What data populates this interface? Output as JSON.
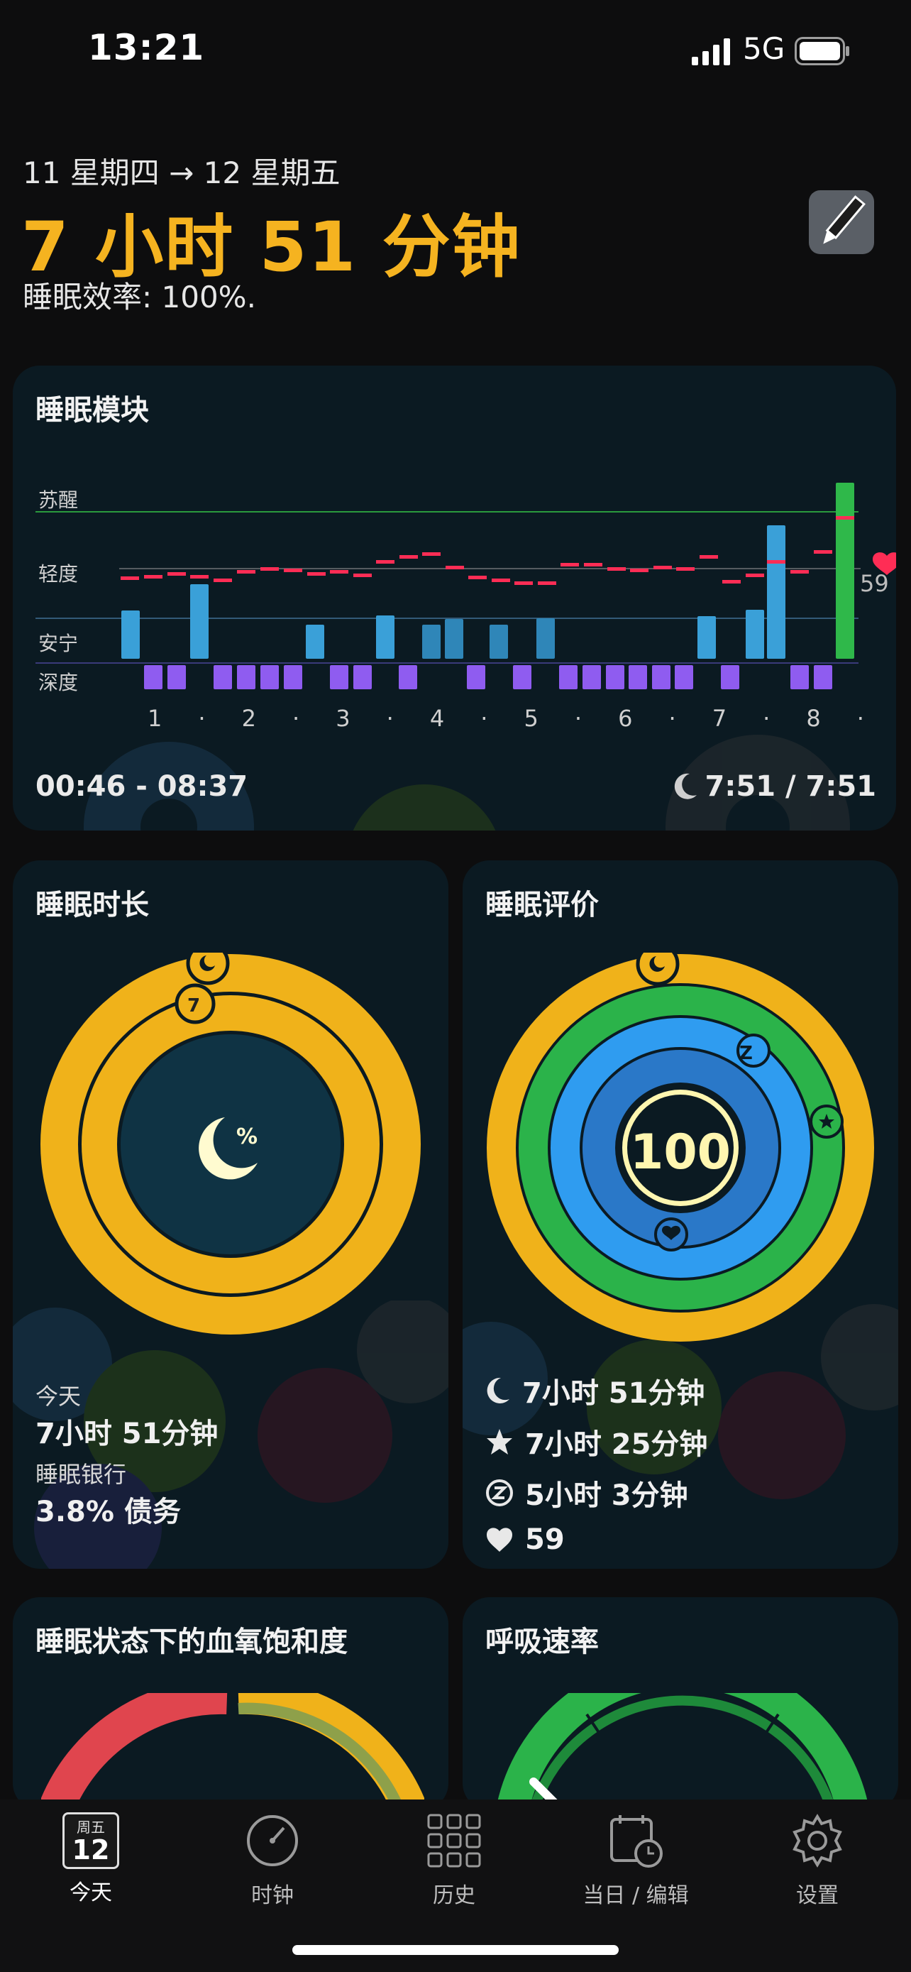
{
  "status_bar": {
    "time": "13:21",
    "network": "5G"
  },
  "header": {
    "date_range": "11 星期四 → 12 星期五",
    "total_sleep": "7 小时 51 分钟",
    "efficiency": "睡眠效率: 100%."
  },
  "sleep_module": {
    "title": "睡眠模块",
    "stages": [
      "苏醒",
      "轻度",
      "安宁",
      "深度"
    ],
    "hour_ticks": [
      "1",
      "·",
      "2",
      "·",
      "3",
      "·",
      "4",
      "·",
      "5",
      "·",
      "6",
      "·",
      "7",
      "·",
      "8",
      "·"
    ],
    "heart_rate": "59",
    "time_range": "00:46 - 08:37",
    "ratio": "7:51 / 7:51",
    "colors": {
      "awake": "#2fb84a",
      "light": "#3aa0d8",
      "deep": "#8f5cf0",
      "heart": "#ff2d55"
    }
  },
  "sleep_duration_card": {
    "title": "睡眠时长",
    "ring_marker": "7",
    "percent_symbol": "%",
    "today_label": "今天",
    "today_value": "7小时 51分钟",
    "bank_label": "睡眠银行",
    "bank_value": "3.8% 债务"
  },
  "sleep_rating_card": {
    "title": "睡眠评价",
    "score": "100",
    "z_marker": "Z",
    "stats": [
      {
        "icon": "moon-icon",
        "text": "7小时 51分钟"
      },
      {
        "icon": "star-icon",
        "text": "7小时 25分钟"
      },
      {
        "icon": "z-circle-icon",
        "text": "5小时 3分钟"
      },
      {
        "icon": "heart-icon",
        "text": "59"
      }
    ]
  },
  "spo2_card": {
    "title": "睡眠状态下的血氧饱和度"
  },
  "respiration_card": {
    "title": "呼吸速率"
  },
  "tab_bar": {
    "today_badge_day": "周五",
    "today_badge_date": "12",
    "tabs": [
      {
        "label": "今天",
        "icon": "calendar-icon"
      },
      {
        "label": "时钟",
        "icon": "clock-icon"
      },
      {
        "label": "历史",
        "icon": "grid-icon"
      },
      {
        "label": "当日 / 编辑",
        "icon": "calendar-clock-icon"
      },
      {
        "label": "设置",
        "icon": "gear-icon"
      }
    ]
  }
}
